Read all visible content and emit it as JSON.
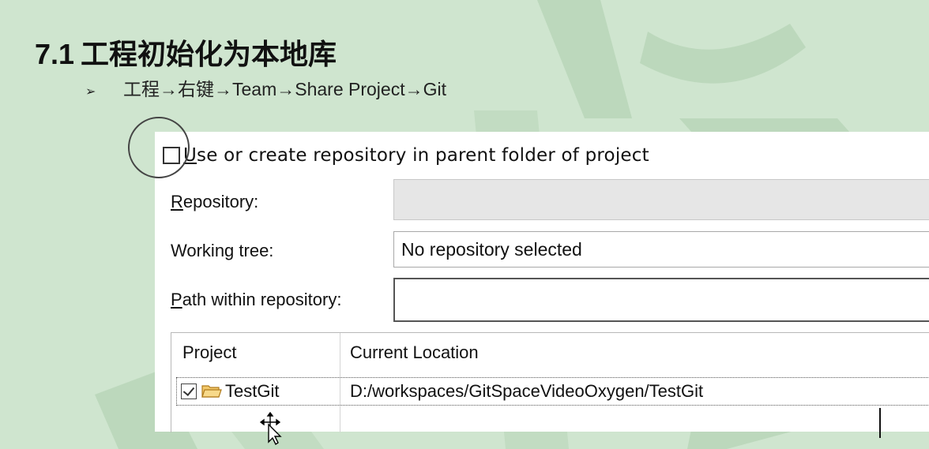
{
  "slide": {
    "title_num": "7.1",
    "title_text": "工程初始化为本地库",
    "bullet_marker": "➢",
    "bullet_text": "工程→右键→Team→Share Project→Git"
  },
  "dialog": {
    "use_parent_checkbox": {
      "label_first": "U",
      "label_rest": "se or create repository in parent folder of project",
      "checked": false
    },
    "repository": {
      "label_first": "R",
      "label_rest": "epository:",
      "value": ""
    },
    "working_tree": {
      "label": "Working tree:",
      "value": "No repository selected"
    },
    "path_within_repo": {
      "label_first": "P",
      "label_rest": "ath within repository:",
      "value": ""
    },
    "table": {
      "columns": [
        "Project",
        "Current Location"
      ],
      "rows": [
        {
          "checked": true,
          "project": "TestGit",
          "location": "D:/workspaces/GitSpaceVideoOxygen/TestGit"
        }
      ]
    }
  },
  "icons": {
    "bullet": "arrowhead-bullet-icon",
    "project_folder": "folder-icon",
    "cursor": "move-cursor-icon"
  },
  "colors": {
    "slide_background": "#cfe5cf",
    "decoration": "#b9d6b9",
    "dialog_background": "#ffffff",
    "disabled_field": "#e6e6e6",
    "annotation_circle": "#444444"
  }
}
